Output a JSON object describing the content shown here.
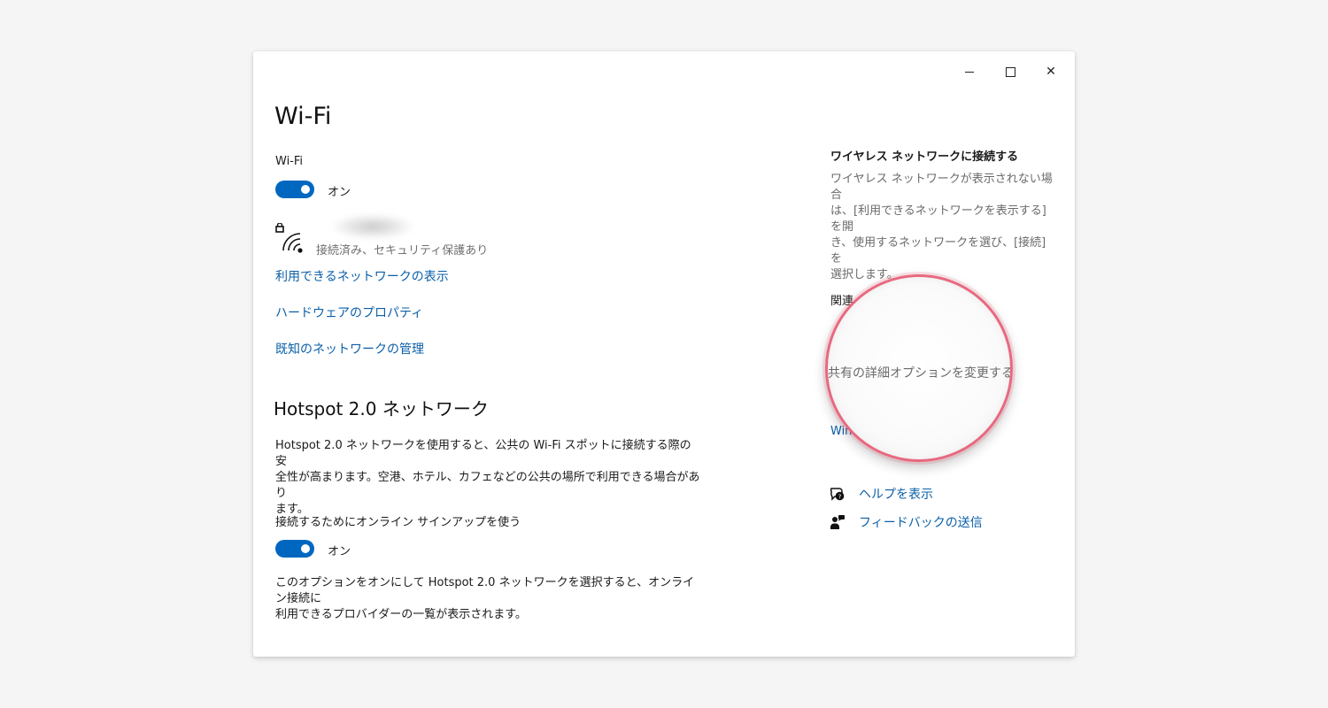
{
  "window": {
    "controls": {
      "minimize": "minimize",
      "maximize": "maximize",
      "close": "✕"
    }
  },
  "page": {
    "title": "Wi-Fi"
  },
  "wifi": {
    "label": "Wi-Fi",
    "toggle_state": "オン",
    "connection_status": "接続済み、セキュリティ保護あり",
    "links": {
      "show_networks": "利用できるネットワークの表示",
      "hardware_properties": "ハードウェアのプロパティ",
      "manage_known": "既知のネットワークの管理"
    }
  },
  "hotspot": {
    "title": "Hotspot 2.0 ネットワーク",
    "description_line1": "Hotspot 2.0 ネットワークを使用すると、公共の Wi-Fi スポットに接続する際の安",
    "description_line2": "全性が高まります。空港、ホテル、カフェなどの公共の場所で利用できる場合があり",
    "description_line3": "ます。",
    "online_signup_label": "接続するためにオンライン サインアップを使う",
    "toggle_state": "オン",
    "note_line1": "このオプションをオンにして Hotspot 2.0 ネットワークを選択すると、オンライン接続に",
    "note_line2": "利用できるプロバイダーの一覧が表示されます。"
  },
  "right_panel": {
    "connect_heading": "ワイヤレス ネットワークに接続する",
    "connect_line1": "ワイヤレス ネットワークが表示されない場合",
    "connect_line2": "は、[利用できるネットワークを表示する] を開",
    "connect_line3": "き、使用するネットワークを選び、[接続] を",
    "connect_line4": "選択します。",
    "related_peek": "関連",
    "magnified_text": "共有の詳細オプションを変更する",
    "win_peek": "Win",
    "help_link": "ヘルプを表示",
    "feedback_link": "フィードバックの送信"
  },
  "colors": {
    "accent": "#0067c0",
    "link": "#0a5fa8",
    "magnifier_border": "#e8697f"
  },
  "icons": {
    "wifi_secured": "wifi-lock-icon",
    "help": "help-chat-icon",
    "feedback": "feedback-person-icon"
  }
}
